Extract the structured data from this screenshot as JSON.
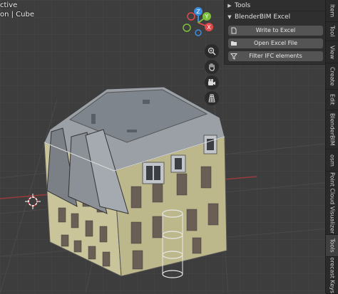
{
  "viewport": {
    "mode_text": "ctive",
    "object_text": "on | Cube"
  },
  "gizmo": {
    "x_label": "X",
    "y_label": "Y",
    "z_label": "Z",
    "x_color": "#e04a4a",
    "y_color": "#7cbf3a",
    "z_color": "#3b8de0"
  },
  "nav_icons": [
    "zoom-icon",
    "hand-pan-icon",
    "camera-icon",
    "grid-view-icon"
  ],
  "panel": {
    "tools_header": "Tools",
    "blenderbim_header": "BlenderBIM Excel",
    "buttons": [
      {
        "label": "Write to Excel",
        "icon": "document-icon"
      },
      {
        "label": "Open Excel File",
        "icon": "folder-icon"
      },
      {
        "label": "Filter IFC elements",
        "icon": "filter-icon"
      }
    ]
  },
  "sidebar_tabs": [
    "Item",
    "Tool",
    "View",
    "Create",
    "Edit",
    "BlenderBIM",
    "osm",
    "Point Cloud Visualizer",
    "Tools",
    "Forecast Keys"
  ]
}
